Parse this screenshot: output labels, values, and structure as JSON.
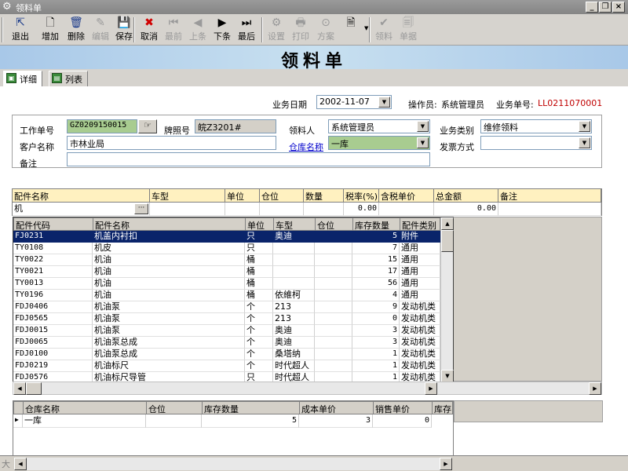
{
  "window": {
    "title": "领料单"
  },
  "toolbar": [
    {
      "label": "退出",
      "icon": "exit-icon",
      "glyph": "⇱",
      "enabled": true
    },
    {
      "label": "增加",
      "icon": "new-doc-icon",
      "glyph": "🗋",
      "enabled": true
    },
    {
      "label": "删除",
      "icon": "trash-icon",
      "glyph": "🗑",
      "enabled": true
    },
    {
      "label": "编辑",
      "icon": "edit-icon",
      "glyph": "✎",
      "enabled": false
    },
    {
      "label": "保存",
      "icon": "save-icon",
      "glyph": "💾",
      "enabled": true
    },
    {
      "label": "取消",
      "icon": "cancel-icon",
      "glyph": "✖",
      "enabled": true
    },
    {
      "label": "最前",
      "icon": "first-icon",
      "glyph": "⏮",
      "enabled": false
    },
    {
      "label": "上条",
      "icon": "prev-icon",
      "glyph": "◀",
      "enabled": false
    },
    {
      "label": "下条",
      "icon": "next-icon",
      "glyph": "▶",
      "enabled": true
    },
    {
      "label": "最后",
      "icon": "last-icon",
      "glyph": "⏭",
      "enabled": true
    },
    {
      "label": "设置",
      "icon": "settings-icon",
      "glyph": "⚙",
      "enabled": false
    },
    {
      "label": "打印",
      "icon": "print-icon",
      "glyph": "🖶",
      "enabled": false
    },
    {
      "label": "方案",
      "icon": "binoculars-icon",
      "glyph": "⊙",
      "enabled": false
    },
    {
      "label": "",
      "icon": "doc-dropdown-icon",
      "glyph": "🗎",
      "enabled": true
    },
    {
      "label": "领料",
      "icon": "check-icon",
      "glyph": "✔",
      "enabled": false
    },
    {
      "label": "单据",
      "icon": "doc-icon",
      "glyph": "🗐",
      "enabled": false
    }
  ],
  "banner": {
    "title": "领料单"
  },
  "tabs": [
    {
      "label": "详细"
    },
    {
      "label": "列表"
    }
  ],
  "header": {
    "date_label": "业务日期",
    "date_value": "2002-11-07",
    "operator_label": "操作员:",
    "operator_value": "系统管理员",
    "docno_label": "业务单号:",
    "docno_value": "LL0211070001"
  },
  "form": {
    "work_no_label": "工作单号",
    "work_no_value": "GZ0209150015",
    "plate_label": "牌照号",
    "plate_value": "皖Z3201#",
    "picker_label": "领料人",
    "picker_value": "系统管理员",
    "biz_type_label": "业务类别",
    "biz_type_value": "维修领料",
    "customer_label": "客户名称",
    "customer_value": "市林业局",
    "warehouse_label": "仓库名称",
    "warehouse_value": "一库",
    "invoice_label": "发票方式",
    "invoice_value": "",
    "remark_label": "备注",
    "remark_value": ""
  },
  "entry_grid": {
    "columns": [
      "配件名称",
      "车型",
      "单位",
      "仓位",
      "数量",
      "税率(%)",
      "含税单价",
      "总金额",
      "备注"
    ],
    "row": {
      "name": "机",
      "rate": "0.00",
      "total": "0.00"
    }
  },
  "lookup_grid": {
    "columns": [
      "配件代码",
      "配件名称",
      "单位",
      "车型",
      "仓位",
      "库存数量",
      "配件类别"
    ],
    "rows": [
      [
        "FJ0231",
        "机盖内衬扣",
        "只",
        "奥迪",
        "",
        "5",
        "附件"
      ],
      [
        "TY0108",
        "机皮",
        "只",
        "",
        "",
        "7",
        "通用"
      ],
      [
        "TY0022",
        "机油",
        "桶",
        "",
        "",
        "15",
        "通用"
      ],
      [
        "TY0021",
        "机油",
        "桶",
        "",
        "",
        "17",
        "通用"
      ],
      [
        "TY0013",
        "机油",
        "桶",
        "",
        "",
        "56",
        "通用"
      ],
      [
        "TY0196",
        "机油",
        "桶",
        "依維柯",
        "",
        "4",
        "通用"
      ],
      [
        "FDJ0406",
        "机油泵",
        "个",
        "213",
        "",
        "9",
        "发动机类"
      ],
      [
        "FDJ0565",
        "机油泵",
        "个",
        "213",
        "",
        "0",
        "发动机类"
      ],
      [
        "FDJ0015",
        "机油泵",
        "个",
        "奥迪",
        "",
        "3",
        "发动机类"
      ],
      [
        "FDJ0065",
        "机油泵总成",
        "个",
        "奥迪",
        "",
        "3",
        "发动机类"
      ],
      [
        "FDJ0100",
        "机油泵总成",
        "个",
        "桑塔纳",
        "",
        "1",
        "发动机类"
      ],
      [
        "FDJ0219",
        "机油标尺",
        "个",
        "时代超人",
        "",
        "1",
        "发动机类"
      ],
      [
        "FDJ0576",
        "机油标尺导管",
        "只",
        "时代超人",
        "",
        "1",
        "发动机类"
      ]
    ]
  },
  "stock_grid": {
    "columns": [
      "仓库名称",
      "仓位",
      "库存数量",
      "成本单价",
      "销售单价",
      "库存"
    ],
    "rows": [
      [
        "一库",
        "",
        "5",
        "3",
        "0"
      ]
    ]
  },
  "status": {
    "text": "大"
  }
}
